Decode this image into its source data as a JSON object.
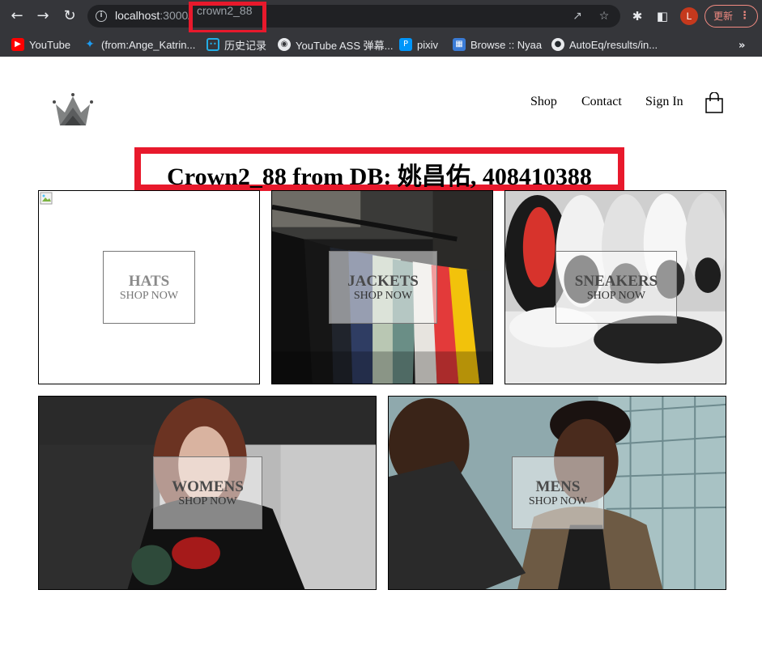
{
  "browser": {
    "url_host": "localhost",
    "url_port": ":3000/",
    "url_path": "crown2_88",
    "avatar_letter": "L",
    "update_label": "更新"
  },
  "bookmarks": [
    {
      "label": "YouTube",
      "icon": "youtube-icon"
    },
    {
      "label": "(from:Ange_Katrin...",
      "icon": "twitter-icon"
    },
    {
      "label": "历史记录",
      "icon": "bilibili-icon"
    },
    {
      "label": "YouTube ASS 弹幕...",
      "icon": "globe-icon"
    },
    {
      "label": "pixiv",
      "icon": "pixiv-icon"
    },
    {
      "label": "Browse :: Nyaa",
      "icon": "nyaa-icon"
    },
    {
      "label": "AutoEq/results/in...",
      "icon": "github-icon"
    }
  ],
  "header": {
    "nav": [
      {
        "label": "Shop"
      },
      {
        "label": "Contact"
      },
      {
        "label": "Sign In"
      }
    ]
  },
  "main": {
    "title": "Crown2_88 from DB: 姚昌佑, 408410388",
    "categories": [
      {
        "title": "HATS",
        "subtitle": "SHOP NOW"
      },
      {
        "title": "JACKETS",
        "subtitle": "SHOP NOW"
      },
      {
        "title": "SNEAKERS",
        "subtitle": "SHOP NOW"
      },
      {
        "title": "WOMENS",
        "subtitle": "SHOP NOW"
      },
      {
        "title": "MENS",
        "subtitle": "SHOP NOW"
      }
    ]
  },
  "colors": {
    "highlight": "#e8192c",
    "chrome": "#35363a",
    "omnibox": "#202124"
  }
}
